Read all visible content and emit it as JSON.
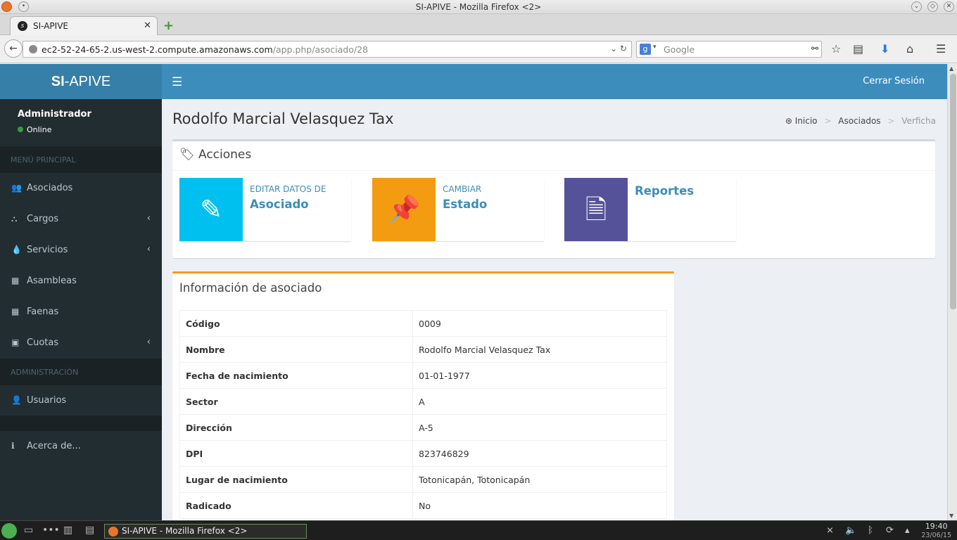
{
  "window": {
    "title": "SI-APIVE - Mozilla Firefox <2>"
  },
  "browser": {
    "tab_title": "SI-APIVE",
    "url_host": "ec2-52-24-65-2.us-west-2.compute.amazonaws.com",
    "url_path": "/app.php/asociado/28",
    "search_placeholder": "Google"
  },
  "sidebar": {
    "logo_bold": "SI",
    "logo_rest": "-APIVE",
    "user_name": "Administrador",
    "user_status": "Online",
    "section_main": "MENÚ PRINCIPAL",
    "section_admin": "ADMINISTRACIÓN",
    "items": [
      {
        "label": "Asociados",
        "icon": "users-icon"
      },
      {
        "label": "Cargos",
        "icon": "sitemap-icon"
      },
      {
        "label": "Servicios",
        "icon": "tint-icon"
      },
      {
        "label": "Asambleas",
        "icon": "calendar-icon"
      },
      {
        "label": "Faenas",
        "icon": "calendar-icon"
      },
      {
        "label": "Cuotas",
        "icon": "money-icon"
      }
    ],
    "admin_items": [
      {
        "label": "Usuarios",
        "icon": "user-icon"
      }
    ],
    "about_label": "Acerca de..."
  },
  "header": {
    "logout_label": "Cerrar Sesión"
  },
  "page": {
    "title": "Rodolfo Marcial Velasquez Tax",
    "breadcrumb": [
      "Inicio",
      "Asociados",
      "Verficha"
    ]
  },
  "actions": {
    "title": "Acciones",
    "boxes": [
      {
        "text": "EDITAR DATOS DE",
        "number": "Asociado",
        "color": "#00c0ef",
        "icon": "edit-icon"
      },
      {
        "text": "CAMBIAR",
        "number": "Estado",
        "color": "#f39c12",
        "icon": "pushpin-icon"
      },
      {
        "text": "",
        "number": "Reportes",
        "color": "#555299",
        "icon": "file-icon"
      }
    ]
  },
  "info": {
    "title": "Información de asociado",
    "rows": [
      {
        "key": "Código",
        "value": "0009"
      },
      {
        "key": "Nombre",
        "value": "Rodolfo Marcial Velasquez Tax"
      },
      {
        "key": "Fecha de nacimiento",
        "value": "01-01-1977"
      },
      {
        "key": "Sector",
        "value": "A"
      },
      {
        "key": "Dirección",
        "value": "A-5"
      },
      {
        "key": "DPI",
        "value": "823746829"
      },
      {
        "key": "Lugar de nacimiento",
        "value": "Totonicapán, Totonicapán"
      },
      {
        "key": "Radicado",
        "value": "No"
      }
    ]
  },
  "taskbar": {
    "task_label": "SI-APIVE - Mozilla Firefox <2>",
    "time": "19:40",
    "date": "23/06/15"
  }
}
